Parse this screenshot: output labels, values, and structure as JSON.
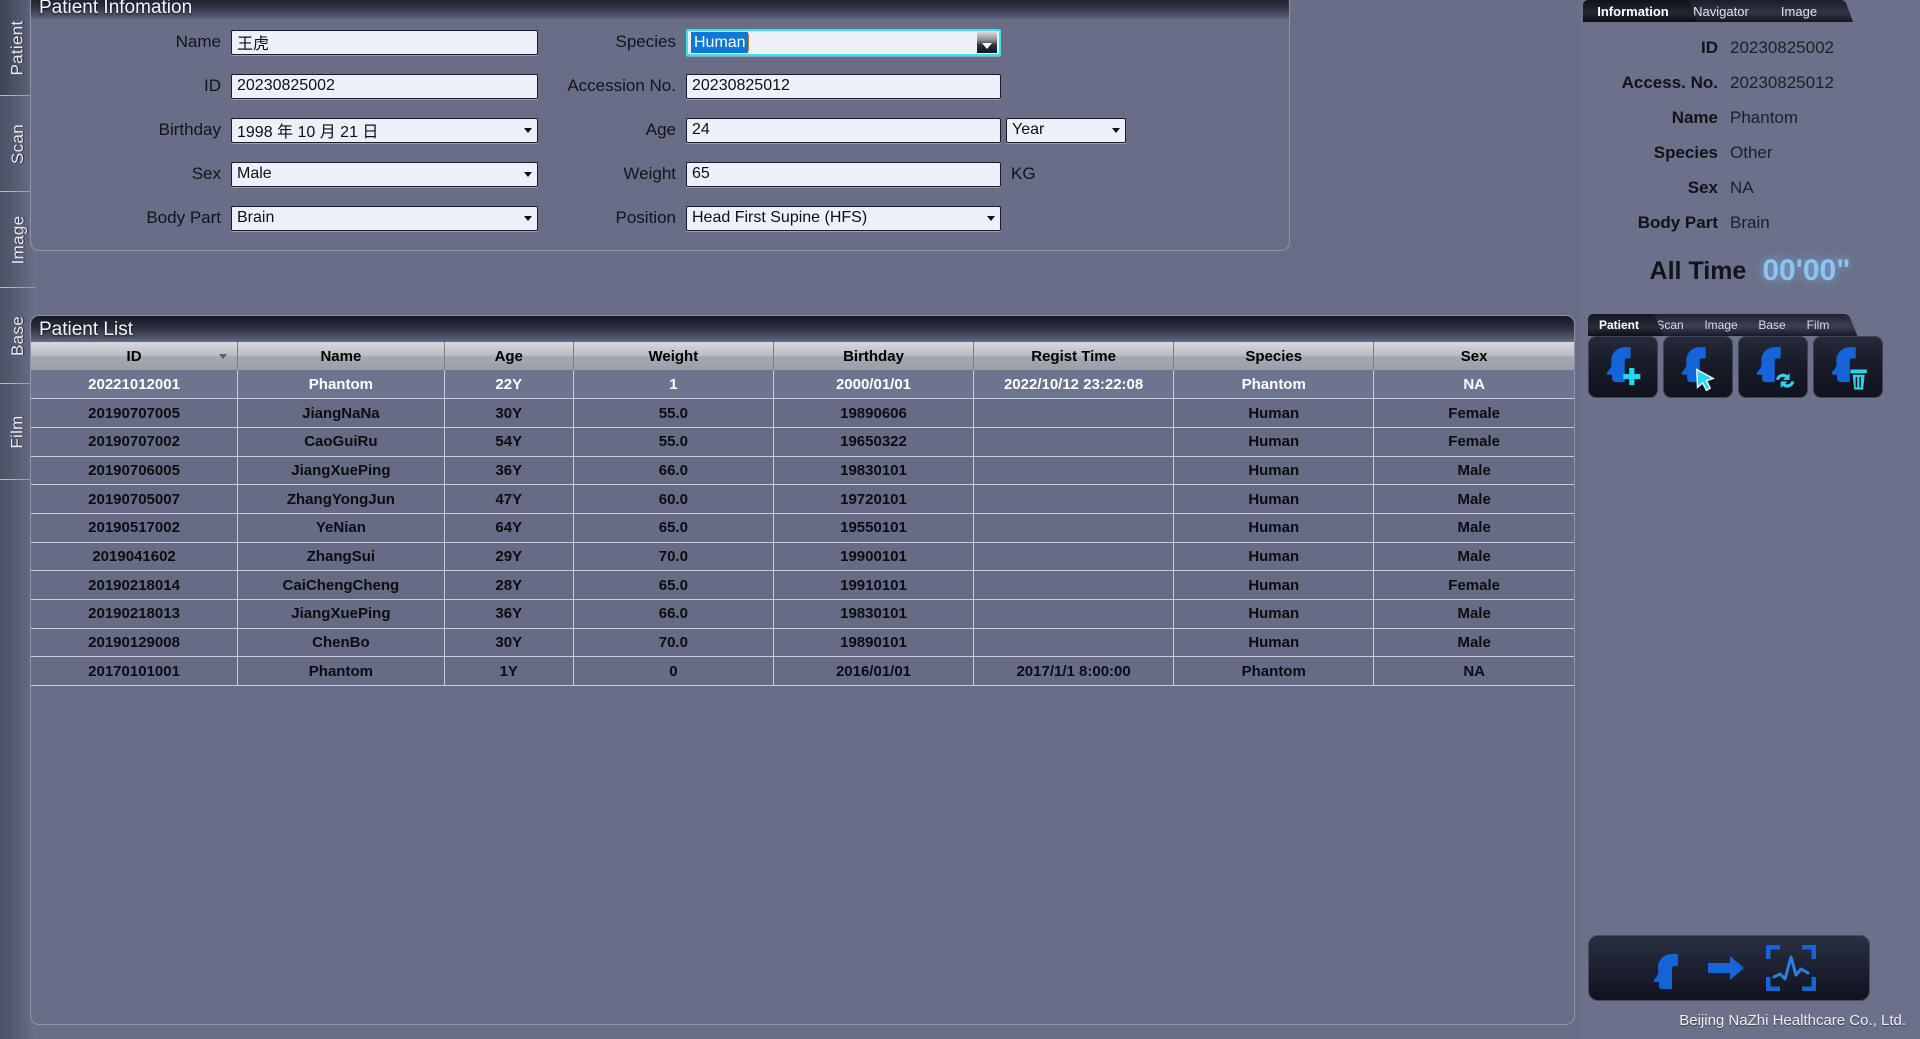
{
  "left_rail": {
    "items": [
      {
        "label": "Patient",
        "active": true
      },
      {
        "label": "Scan",
        "active": false
      },
      {
        "label": "Image",
        "active": false
      },
      {
        "label": "Base",
        "active": false
      },
      {
        "label": "Film",
        "active": false
      }
    ]
  },
  "info_panel": {
    "title": "Patient Infomation",
    "left_fields": [
      {
        "label": "Name",
        "value": "王虎",
        "type": "text"
      },
      {
        "label": "ID",
        "value": "20230825002",
        "type": "text"
      },
      {
        "label": "Birthday",
        "value": "1998 年 10 月 21 日",
        "type": "combo"
      },
      {
        "label": "Sex",
        "value": "Male",
        "type": "combo"
      },
      {
        "label": "Body Part",
        "value": "Brain",
        "type": "combo"
      }
    ],
    "right_fields": [
      {
        "label": "Species",
        "value": "Human",
        "type": "focused-combo",
        "unit": ""
      },
      {
        "label": "Accession No.",
        "value": "20230825012",
        "type": "text",
        "unit": ""
      },
      {
        "label": "Age",
        "value": "24",
        "type": "text",
        "unit_combo": "Year"
      },
      {
        "label": "Weight",
        "value": "65",
        "type": "text",
        "unit": "KG"
      },
      {
        "label": "Position",
        "value": "Head First Supine (HFS)",
        "type": "combo",
        "unit": ""
      }
    ]
  },
  "patient_list": {
    "title": "Patient List",
    "sorted_column": "ID",
    "columns": [
      "ID",
      "Name",
      "Age",
      "Weight",
      "Birthday",
      "Regist Time",
      "Species",
      "Sex"
    ],
    "rows": [
      {
        "selected": true,
        "cells": [
          "20221012001",
          "Phantom",
          "22Y",
          "1",
          "2000/01/01",
          "2022/10/12 23:22:08",
          "Phantom",
          "NA"
        ]
      },
      {
        "selected": false,
        "cells": [
          "20190707005",
          "JiangNaNa",
          "30Y",
          "55.0",
          "19890606",
          "",
          "Human",
          "Female"
        ]
      },
      {
        "selected": false,
        "cells": [
          "20190707002",
          "CaoGuiRu",
          "54Y",
          "55.0",
          "19650322",
          "",
          "Human",
          "Female"
        ]
      },
      {
        "selected": false,
        "cells": [
          "20190706005",
          "JiangXuePing",
          "36Y",
          "66.0",
          "19830101",
          "",
          "Human",
          "Male"
        ]
      },
      {
        "selected": false,
        "cells": [
          "20190705007",
          "ZhangYongJun",
          "47Y",
          "60.0",
          "19720101",
          "",
          "Human",
          "Male"
        ]
      },
      {
        "selected": false,
        "cells": [
          "20190517002",
          "YeNian",
          "64Y",
          "65.0",
          "19550101",
          "",
          "Human",
          "Male"
        ]
      },
      {
        "selected": false,
        "cells": [
          "2019041602",
          "ZhangSui",
          "29Y",
          "70.0",
          "19900101",
          "",
          "Human",
          "Male"
        ]
      },
      {
        "selected": false,
        "cells": [
          "20190218014",
          "CaiChengCheng",
          "28Y",
          "65.0",
          "19910101",
          "",
          "Human",
          "Female"
        ]
      },
      {
        "selected": false,
        "cells": [
          "20190218013",
          "JiangXuePing",
          "36Y",
          "66.0",
          "19830101",
          "",
          "Human",
          "Male"
        ]
      },
      {
        "selected": false,
        "cells": [
          "20190129008",
          "ChenBo",
          "30Y",
          "70.0",
          "19890101",
          "",
          "Human",
          "Male"
        ]
      },
      {
        "selected": false,
        "cells": [
          "20170101001",
          "Phantom",
          "1Y",
          "0",
          "2016/01/01",
          "2017/1/1 8:00:00",
          "Phantom",
          "NA"
        ]
      }
    ]
  },
  "sidebar": {
    "tabs": [
      {
        "label": "Information",
        "active": true
      },
      {
        "label": "Navigator",
        "active": false
      },
      {
        "label": "Image",
        "active": false
      }
    ],
    "information": [
      {
        "key": "ID",
        "value": "20230825002"
      },
      {
        "key": "Access. No.",
        "value": "20230825012"
      },
      {
        "key": "Name",
        "value": "Phantom"
      },
      {
        "key": "Species",
        "value": "Other"
      },
      {
        "key": "Sex",
        "value": "NA"
      },
      {
        "key": "Body Part",
        "value": "Brain"
      }
    ],
    "all_time": {
      "label": "All Time",
      "value": "00'00\""
    },
    "mode_tabs": [
      {
        "label": "Patient",
        "active": true
      },
      {
        "label": "Scan",
        "active": false
      },
      {
        "label": "Image",
        "active": false
      },
      {
        "label": "Base",
        "active": false
      },
      {
        "label": "Film",
        "active": false
      }
    ],
    "actions": [
      {
        "icon": "add-patient-icon",
        "name": "add-patient-button"
      },
      {
        "icon": "select-patient-icon",
        "name": "select-patient-button"
      },
      {
        "icon": "update-patient-icon",
        "name": "update-patient-button"
      },
      {
        "icon": "delete-patient-icon",
        "name": "delete-patient-button"
      }
    ],
    "start_scan": {
      "name": "start-scan-button"
    },
    "brand": "Beijing NaZhi Healthcare Co., Ltd."
  },
  "colors": {
    "background": "#6a7189",
    "panel_header_dark": "#171a22",
    "field_background": "#edf0f9",
    "focus_border": "#2ee6f5",
    "selection_blue": "#1176d4",
    "accent_cyan": "#8fc3ef",
    "icon_blue": "#1565d8"
  }
}
